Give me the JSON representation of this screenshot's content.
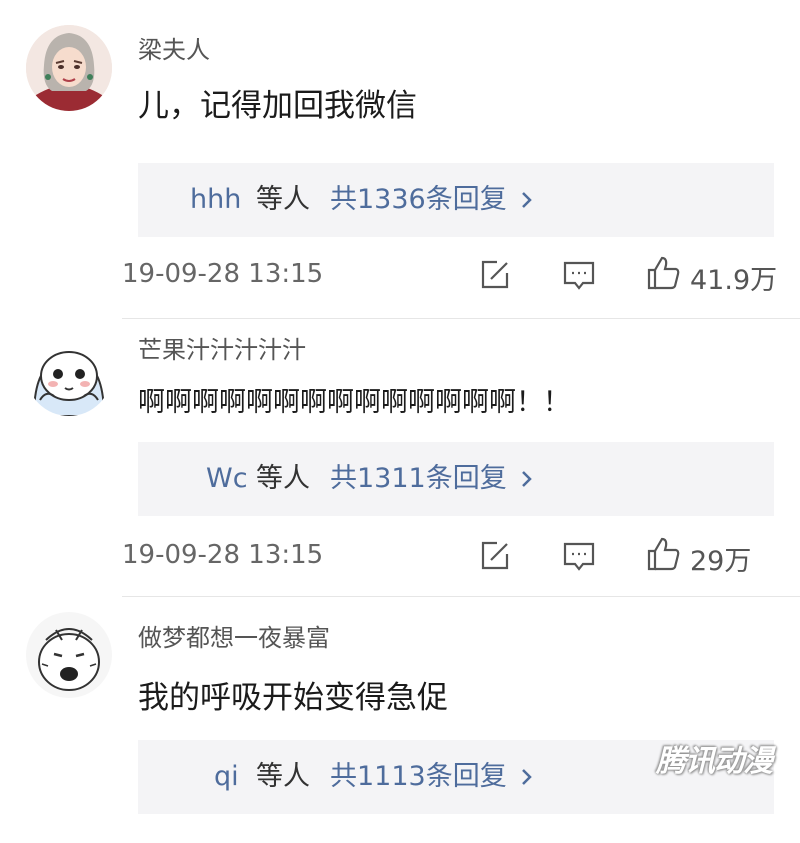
{
  "comments": [
    {
      "username": "梁夫人",
      "content": "儿，记得加回我微信",
      "reply_user": "hhh",
      "reply_mid": "等人",
      "reply_count": "共1336条回复",
      "time": "19-09-28  13:15",
      "likes": "41.9万"
    },
    {
      "username": "芒果汁汁汁汁汁",
      "content": "啊啊啊啊啊啊啊啊啊啊啊啊啊啊！！",
      "reply_user": "Wc",
      "reply_mid": "等人",
      "reply_count": "共1311条回复",
      "time": "19-09-28  13:15",
      "likes": "29万"
    },
    {
      "username": "做梦都想一夜暴富",
      "content": "我的呼吸开始变得急促",
      "reply_user": "qi",
      "reply_mid": "等人",
      "reply_count": "共1113条回复"
    }
  ],
  "watermark": "腾讯动漫",
  "icons": {
    "edit": "edit-icon",
    "comment": "comment-icon",
    "like": "thumbs-up-icon",
    "chevron": "chevron-right-icon"
  },
  "colors": {
    "link": "#4e6c9c",
    "reply_bg": "#f4f4f6"
  }
}
